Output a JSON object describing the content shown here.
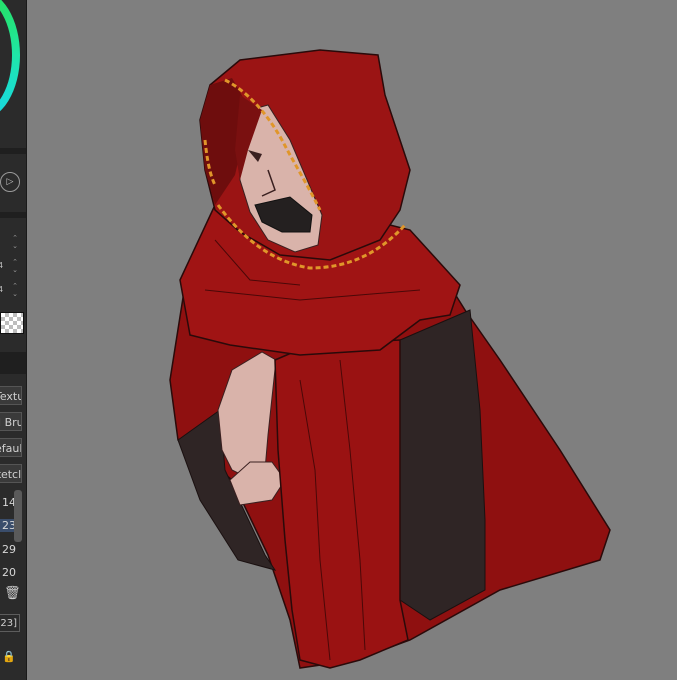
{
  "sidebar": {
    "play_symbol": "▷",
    "stepper_values": [
      "",
      "4",
      "4"
    ],
    "brush_items": [
      "Textur",
      "il Bru",
      "efaul",
      "ketcl"
    ],
    "layer_numbers": [
      "14",
      "23",
      "29",
      "20"
    ],
    "selected_index": 1,
    "trash_symbol": "🗑",
    "page_box_label": "23]",
    "lock_symbol": "🔒"
  },
  "colors": {
    "canvas_bg": "#7f7f7f",
    "cloak_red": "#9a1212",
    "cloak_shadow": "#6e0d0d",
    "dark_panel": "#2f2525",
    "skin": "#d9b3aa",
    "gold_trim": "#e0962a",
    "wheel_green": "#27e05a",
    "wheel_cyan": "#17d6e8"
  },
  "icons": {
    "play": "play-icon",
    "trash": "trash-icon",
    "lock": "lock-icon",
    "checker": "transparency-checker-icon"
  }
}
